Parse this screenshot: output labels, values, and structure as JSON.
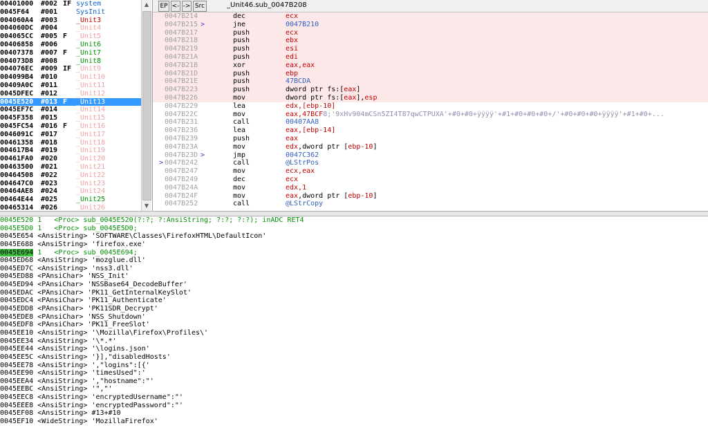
{
  "units": [
    {
      "addr": "00401000",
      "num": "#002",
      "flag": "IF",
      "name": "system",
      "color": "#1060d0"
    },
    {
      "addr": "0045F64",
      "num": "#001",
      "flag": "",
      "name": "SysInit",
      "color": "#1060d0"
    },
    {
      "addr": "004060A4",
      "num": "#003",
      "flag": "",
      "name": "_Unit3",
      "color": "#c00000"
    },
    {
      "addr": "004060DC",
      "num": "#004",
      "flag": "",
      "name": "_Unit4",
      "color": "#f0a0a0"
    },
    {
      "addr": "004065CC",
      "num": "#005",
      "flag": "F",
      "name": "_Unit5",
      "color": "#f0a0a0"
    },
    {
      "addr": "00406858",
      "num": "#006",
      "flag": "",
      "name": "_Unit6",
      "color": "#009000"
    },
    {
      "addr": "00407378",
      "num": "#007",
      "flag": "F",
      "name": "_Unit7",
      "color": "#009000"
    },
    {
      "addr": "004073D8",
      "num": "#008",
      "flag": "",
      "name": "_Unit8",
      "color": "#009000"
    },
    {
      "addr": "004076EC",
      "num": "#009",
      "flag": "IF",
      "name": "_Unit9",
      "color": "#f0a0a0"
    },
    {
      "addr": "004099B4",
      "num": "#010",
      "flag": "",
      "name": "_Unit10",
      "color": "#f0a0a0"
    },
    {
      "addr": "00409A0C",
      "num": "#011",
      "flag": "",
      "name": "_Unit11",
      "color": "#f0a0a0"
    },
    {
      "addr": "0045DFEC",
      "num": "#012",
      "flag": "",
      "name": "_Unit12",
      "color": "#f0a0a0"
    },
    {
      "addr": "0045E520",
      "num": "#013",
      "flag": "F",
      "name": "_Unit13",
      "color": "#ffffff"
    },
    {
      "addr": "0045EF7C",
      "num": "#014",
      "flag": "",
      "name": "_Unit14",
      "color": "#f0a0a0"
    },
    {
      "addr": "0045F358",
      "num": "#015",
      "flag": "",
      "name": "_Unit15",
      "color": "#f0a0a0"
    },
    {
      "addr": "0045FC54",
      "num": "#016",
      "flag": "F",
      "name": "_Unit16",
      "color": "#f0a0a0"
    },
    {
      "addr": "0046091C",
      "num": "#017",
      "flag": "",
      "name": "_Unit17",
      "color": "#f0a0a0"
    },
    {
      "addr": "00461358",
      "num": "#018",
      "flag": "",
      "name": "_Unit18",
      "color": "#f0a0a0"
    },
    {
      "addr": "004617B4",
      "num": "#019",
      "flag": "",
      "name": "_Unit19",
      "color": "#f0a0a0"
    },
    {
      "addr": "00461FA0",
      "num": "#020",
      "flag": "",
      "name": "_Unit20",
      "color": "#f0a0a0"
    },
    {
      "addr": "00463500",
      "num": "#021",
      "flag": "",
      "name": "_Unit21",
      "color": "#f0a0a0"
    },
    {
      "addr": "00464508",
      "num": "#022",
      "flag": "",
      "name": "_Unit22",
      "color": "#f0a0a0"
    },
    {
      "addr": "004647C0",
      "num": "#023",
      "flag": "",
      "name": "_Unit23",
      "color": "#f0a0a0"
    },
    {
      "addr": "00464AE8",
      "num": "#024",
      "flag": "",
      "name": "_Unit24",
      "color": "#f0a0a0"
    },
    {
      "addr": "00464E44",
      "num": "#025",
      "flag": "",
      "name": "_Unit25",
      "color": "#009000"
    },
    {
      "addr": "00465314",
      "num": "#026",
      "flag": "",
      "name": "_Unit26",
      "color": "#f0a0a0"
    }
  ],
  "selected_unit_index": 12,
  "toolbar": {
    "ep": "EP",
    "back": "<-",
    "fwd": "->",
    "src": "Src",
    "title": "_Unit46.sub_0047B208"
  },
  "asm": [
    {
      "addr": "0047B214",
      "mark": "",
      "arrow": "",
      "mn": "dec",
      "op": "ecx",
      "opc": "red",
      "hl": true
    },
    {
      "addr": "0047B215",
      "mark": "",
      "arrow": ">",
      "mn": "jne",
      "op": "0047B210",
      "opc": "blue",
      "hl": true
    },
    {
      "addr": "0047B217",
      "mark": "",
      "arrow": "",
      "mn": "push",
      "op": "ecx",
      "opc": "red",
      "hl": true
    },
    {
      "addr": "0047B218",
      "mark": "",
      "arrow": "",
      "mn": "push",
      "op": "ebx",
      "opc": "red",
      "hl": true
    },
    {
      "addr": "0047B219",
      "mark": "",
      "arrow": "",
      "mn": "push",
      "op": "esi",
      "opc": "red",
      "hl": true
    },
    {
      "addr": "0047B21A",
      "mark": "",
      "arrow": "",
      "mn": "push",
      "op": "edi",
      "opc": "red",
      "hl": true
    },
    {
      "addr": "0047B21B",
      "mark": "",
      "arrow": "",
      "mn": "xor",
      "op": "eax,eax",
      "opc": "red",
      "hl": true
    },
    {
      "addr": "0047B21D",
      "mark": "",
      "arrow": "",
      "mn": "push",
      "op": "ebp",
      "opc": "red",
      "hl": true
    },
    {
      "addr": "0047B21E",
      "mark": "",
      "arrow": "",
      "mn": "push",
      "op": "47BCDA",
      "opc": "blue",
      "hl": true
    },
    {
      "addr": "0047B223",
      "mark": "",
      "arrow": "",
      "mn": "push",
      "op": "dword ptr fs:[eax]",
      "opc": "mixed_push_fs",
      "hl": true
    },
    {
      "addr": "0047B226",
      "mark": "",
      "arrow": "",
      "mn": "mov",
      "op": "dword ptr fs:[eax],esp",
      "opc": "mixed_mov_fs",
      "hl": true
    },
    {
      "addr": "0047B229",
      "mark": "",
      "arrow": "",
      "mn": "lea",
      "op": "edx,[ebp-10]",
      "opc": "red",
      "hl": false
    },
    {
      "addr": "0047B22C",
      "mark": "",
      "arrow": "",
      "mn": "mov",
      "op": "eax,47BCF8;'9xHv904mCSn5ZI4T87qwCTPUXA'+#0+#0+ÿÿÿÿ'+#1+#0+#0+#0+/'+#0+#0+#0+ÿÿÿÿ'+#1+#0+...",
      "opc": "grey",
      "hl": false
    },
    {
      "addr": "0047B231",
      "mark": "",
      "arrow": "",
      "mn": "call",
      "op": "00407AA8",
      "opc": "blue",
      "hl": false
    },
    {
      "addr": "0047B236",
      "mark": "",
      "arrow": "",
      "mn": "lea",
      "op": "eax,[ebp-14]",
      "opc": "red",
      "hl": false
    },
    {
      "addr": "0047B239",
      "mark": "",
      "arrow": "",
      "mn": "push",
      "op": "eax",
      "opc": "red",
      "hl": false
    },
    {
      "addr": "0047B23A",
      "mark": "",
      "arrow": "",
      "mn": "mov",
      "op": "edx,dword ptr [ebp-10]",
      "opc": "mixed_edx_ptr",
      "hl": false
    },
    {
      "addr": "0047B23D",
      "mark": "",
      "arrow": ">",
      "mn": "jmp",
      "op": "0047C362",
      "opc": "blue",
      "hl": false
    },
    {
      "addr": "0047B242",
      "mark": ">",
      "arrow": "",
      "mn": "call",
      "op": "@LStrPos",
      "opc": "blue",
      "hl": false
    },
    {
      "addr": "0047B247",
      "mark": "",
      "arrow": "",
      "mn": "mov",
      "op": "ecx,eax",
      "opc": "red",
      "hl": false
    },
    {
      "addr": "0047B249",
      "mark": "",
      "arrow": "",
      "mn": "dec",
      "op": "ecx",
      "opc": "red",
      "hl": false
    },
    {
      "addr": "0047B24A",
      "mark": "",
      "arrow": "",
      "mn": "mov",
      "op": "edx,1",
      "opc": "red",
      "hl": false
    },
    {
      "addr": "0047B24F",
      "mark": "",
      "arrow": "",
      "mn": "mov",
      "op": "eax,dword ptr [ebp-10]",
      "opc": "mixed_eax_ptr",
      "hl": false
    },
    {
      "addr": "0047B252",
      "mark": "",
      "arrow": "",
      "mn": "call",
      "op": "@LStrCopy",
      "opc": "blue",
      "hl": false
    }
  ],
  "strings": [
    {
      "addr": "0045E520",
      "text": " 1   <Proc> sub_0045E520(?:?; ?:AnsiString; ?:?; ?:?); inADC RET4",
      "proc": true
    },
    {
      "addr": "0045E5D0",
      "text": " 1   <Proc> sub_0045E5D0;",
      "proc": true
    },
    {
      "addr": "0045E654",
      "text": " <AnsiString> 'SOFTWARE\\Classes\\FirefoxHTML\\DefaultIcon'",
      "proc": false
    },
    {
      "addr": "0045E688",
      "text": " <AnsiString> 'firefox.exe'",
      "proc": false
    },
    {
      "addr": "0045E694",
      "text": " 1   <Proc> sub_0045E694;",
      "proc": true
    },
    {
      "addr": "0045ED68",
      "text": " <AnsiString> 'mozglue.dll'",
      "proc": false
    },
    {
      "addr": "0045ED7C",
      "text": " <AnsiString> 'nss3.dll'",
      "proc": false
    },
    {
      "addr": "0045ED88",
      "text": " <PAnsiChar> 'NSS_Init'",
      "proc": false
    },
    {
      "addr": "0045ED94",
      "text": " <PAnsiChar> 'NSSBase64_DecodeBuffer'",
      "proc": false
    },
    {
      "addr": "0045EDAC",
      "text": " <PAnsiChar> 'PK11_GetInternalKeySlot'",
      "proc": false
    },
    {
      "addr": "0045EDC4",
      "text": " <PAnsiChar> 'PK11_Authenticate'",
      "proc": false
    },
    {
      "addr": "0045EDD8",
      "text": " <PAnsiChar> 'PK11SDR_Decrypt'",
      "proc": false
    },
    {
      "addr": "0045EDE8",
      "text": " <PAnsiChar> 'NSS_Shutdown'",
      "proc": false
    },
    {
      "addr": "0045EDF8",
      "text": " <PAnsiChar> 'PK11_FreeSlot'",
      "proc": false
    },
    {
      "addr": "0045EE10",
      "text": " <AnsiString> '\\Mozilla\\Firefox\\Profiles\\'",
      "proc": false
    },
    {
      "addr": "0045EE34",
      "text": " <AnsiString> '\\*.*'",
      "proc": false
    },
    {
      "addr": "0045EE44",
      "text": " <AnsiString> '\\logins.json'",
      "proc": false
    },
    {
      "addr": "0045EE5C",
      "text": " <AnsiString> '}],\"disabledHosts'",
      "proc": false
    },
    {
      "addr": "0045EE78",
      "text": " <AnsiString> ',\"logins\":[{'",
      "proc": false
    },
    {
      "addr": "0045EE90",
      "text": " <AnsiString> 'timesUsed\":'",
      "proc": false
    },
    {
      "addr": "0045EEA4",
      "text": " <AnsiString> ',\"hostname\":\"'",
      "proc": false
    },
    {
      "addr": "0045EEBC",
      "text": " <AnsiString> '\",\"'",
      "proc": false
    },
    {
      "addr": "0045EEC8",
      "text": " <AnsiString> 'encryptedUsername\":\"'",
      "proc": false
    },
    {
      "addr": "0045EEE8",
      "text": " <AnsiString> 'encryptedPassword\":\"'",
      "proc": false
    },
    {
      "addr": "0045EF08",
      "text": " <AnsiString> #13+#10",
      "proc": false
    },
    {
      "addr": "0045EF10",
      "text": " <WideString> 'MozillaFirefox'",
      "proc": false
    }
  ]
}
